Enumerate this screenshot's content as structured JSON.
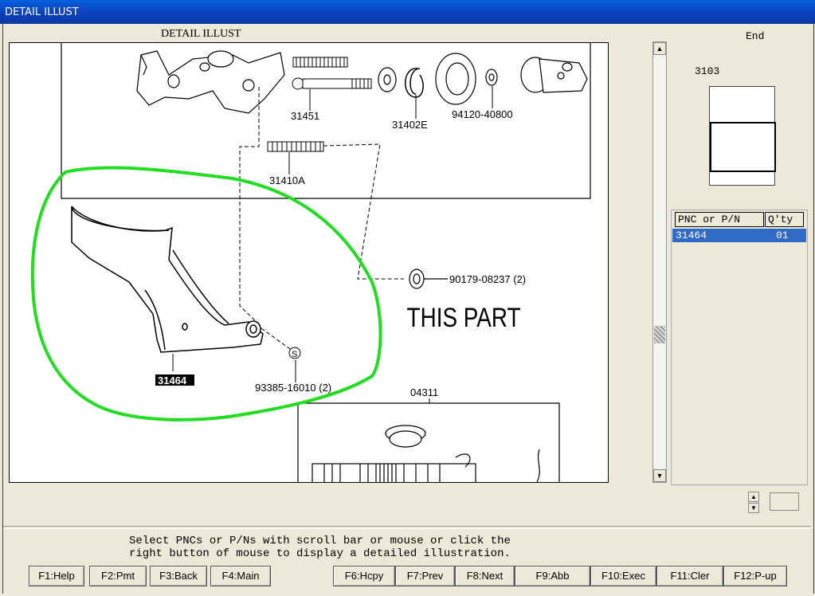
{
  "window": {
    "title": "DETAIL ILLUST"
  },
  "illustration": {
    "title": "DETAIL ILLUST",
    "labels": {
      "p31451": "31451",
      "p31402E": "31402E",
      "p94120": "94120-40800",
      "p31410A": "31410A",
      "p90179": "90179-08237 (2)",
      "p31464": "31464",
      "p93385": "93385-16010 (2)",
      "p04311": "04311",
      "annotation": "THIS PART",
      "bolt_symbol": "S"
    },
    "highlight_color": "#22dd22"
  },
  "side": {
    "end_label": "End",
    "figure_code": "3103"
  },
  "parts_list": {
    "headers": [
      "PNC or P/N",
      "Q'ty"
    ],
    "rows": [
      {
        "pnc": "31464",
        "qty": "01"
      }
    ]
  },
  "status": {
    "line1": "Select PNCs or P/Ns with scroll bar or mouse or click the",
    "line2": "right button of mouse to display a detailed illustration."
  },
  "function_keys": {
    "f1": "F1:Help",
    "f2": "F2:Pmt",
    "f3": "F3:Back",
    "f4": "F4:Main",
    "f6": "F6:Hcpy",
    "f7": "F7:Prev",
    "f8": "F8:Next",
    "f9": "F9:Abb",
    "f10": "F10:Exec",
    "f11": "F11:Cler",
    "f12": "F12:P-up"
  }
}
